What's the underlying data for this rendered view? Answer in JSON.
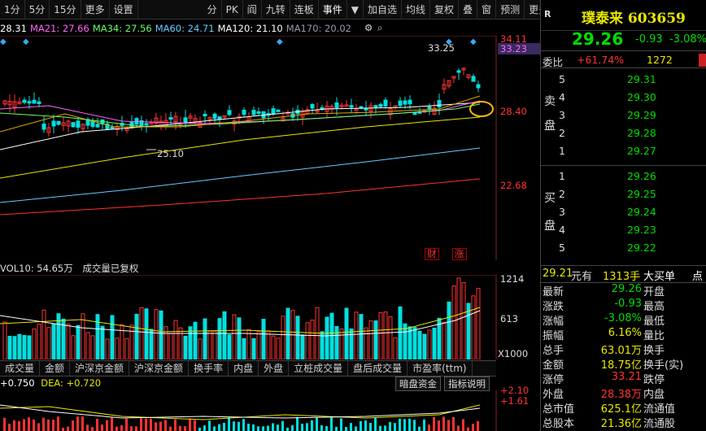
{
  "toolbar": {
    "items": [
      "1分",
      "5分",
      "15分",
      "更多",
      "设置",
      "分",
      "PK",
      "阎",
      "九转",
      "连板",
      "事件",
      "▼",
      "加自选",
      "均线",
      "复权",
      "叠",
      "窗",
      "预测",
      "更多"
    ],
    "selected_index": 10
  },
  "ma": {
    "ma5": "28.31",
    "ma21": "MA21: 27.66",
    "ma34": "MA34: 27.56",
    "ma60": "MA60: 24.71",
    "ma120": "MA120: 21.10",
    "ma170": "MA170: 20.02",
    "colors": {
      "ma5": "#ffffff",
      "ma21": "#ff66ff",
      "ma34": "#66ff66",
      "ma60": "#66ccff",
      "ma120": "#ffffff",
      "ma170": "#9999aa"
    }
  },
  "main_axis": {
    "labels": [
      "34.11",
      "33.23",
      "28.40",
      "22.68"
    ],
    "colors": {
      "34.11": "#ff3333",
      "33.23": "#ff66ff",
      "28.40": "#ff3333",
      "22.68": "#ff3333"
    }
  },
  "annotations": {
    "high": "33.25",
    "low": "25.10",
    "badge_cai": "财",
    "badge_zhang": "涨"
  },
  "volume": {
    "header_label": "VOL10: 54.65万",
    "header_note": "成交量已复权",
    "axis": [
      "1214",
      "613",
      "X1000"
    ]
  },
  "tabs": [
    "成交量",
    "金额",
    "沪深京金额",
    "沪深京金额",
    "换手率",
    "内盘",
    "外盘",
    "立桩成交量",
    "盘后成交量",
    "市盈率(ttm)"
  ],
  "macd": {
    "header_a": "+0.750",
    "header_b": "DEA: +0.720",
    "buttons": [
      "暗盘资金",
      "指标说明"
    ],
    "axis": [
      "+2.10",
      "+1.61"
    ]
  },
  "quote": {
    "badge": "R",
    "name": "璞泰来 603659",
    "price": "29.26",
    "change": "-0.93",
    "change_pct": "-3.08%",
    "weibi_label": "委比",
    "weibi_pct": "+61.74%",
    "weibi_vol": "1272",
    "sell_side_label": [
      "卖",
      "盘"
    ],
    "buy_side_label": [
      "买",
      "盘"
    ],
    "sell": [
      {
        "level": "5",
        "price": "29.31"
      },
      {
        "level": "4",
        "price": "29.30"
      },
      {
        "level": "3",
        "price": "29.29"
      },
      {
        "level": "2",
        "price": "29.28"
      },
      {
        "level": "1",
        "price": "29.27"
      }
    ],
    "buy": [
      {
        "level": "1",
        "price": "29.26"
      },
      {
        "level": "2",
        "price": "29.25"
      },
      {
        "level": "3",
        "price": "29.24"
      },
      {
        "level": "4",
        "price": "29.23"
      },
      {
        "level": "5",
        "price": "29.22"
      }
    ],
    "trade_price": "29.21",
    "trade_unit": "元有",
    "trade_vol": "1313手",
    "trade_type": "大买单",
    "trade_more": "点"
  },
  "stats": [
    {
      "l": "最新",
      "v": "29.26",
      "vc": "green",
      "l2": "开盘"
    },
    {
      "l": "涨跌",
      "v": "-0.93",
      "vc": "green",
      "l2": "最高"
    },
    {
      "l": "涨幅",
      "v": "-3.08%",
      "vc": "green",
      "l2": "最低"
    },
    {
      "l": "振幅",
      "v": "6.16%",
      "vc": "yellow",
      "l2": "量比"
    },
    {
      "l": "总手",
      "v": "63.01万",
      "vc": "yellow",
      "l2": "换手"
    },
    {
      "l": "金额",
      "v": "18.75亿",
      "vc": "yellow",
      "l2": "换手(实)"
    },
    {
      "l": "涨停",
      "v": "33.21",
      "vc": "red",
      "l2": "跌停"
    },
    {
      "l": "外盘",
      "v": "28.38万",
      "vc": "red",
      "l2": "内盘"
    },
    {
      "l": "总市值",
      "v": "625.1亿",
      "vc": "yellow",
      "l2": "流通值"
    },
    {
      "l": "总股本",
      "v": "21.36亿",
      "vc": "yellow",
      "l2": "流通股"
    }
  ]
}
